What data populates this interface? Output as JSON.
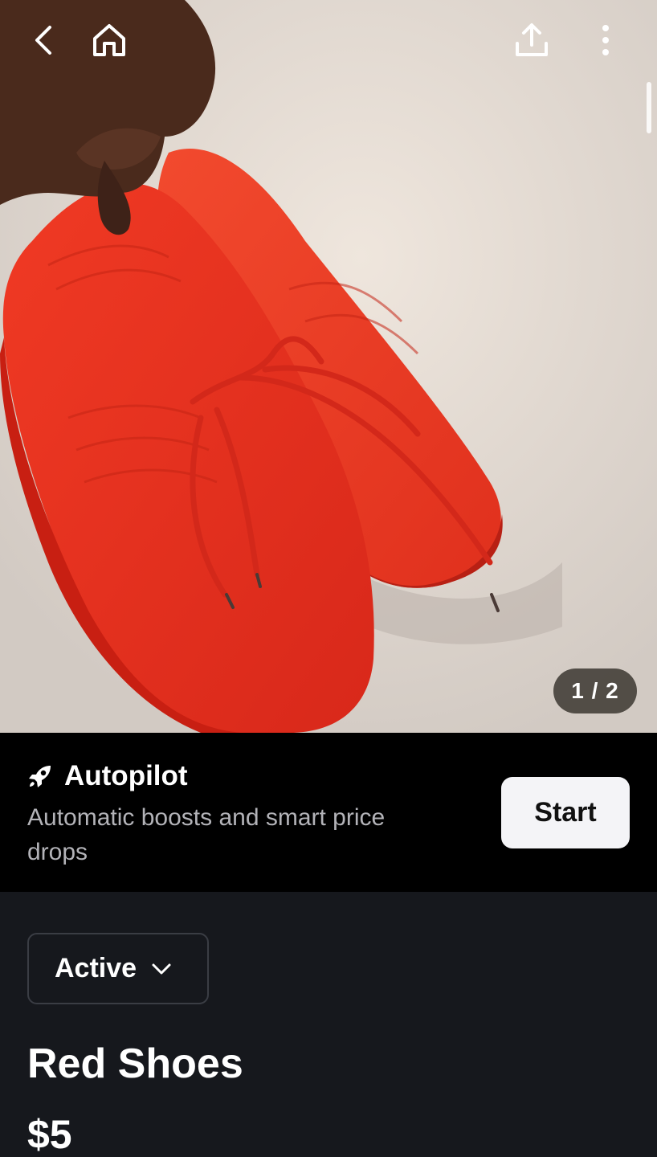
{
  "header": {
    "back_icon": "chevron-left-icon",
    "home_icon": "home-icon",
    "share_icon": "share-upload-icon",
    "more_icon": "more-vertical-icon"
  },
  "gallery": {
    "counter": "1 / 2",
    "image_description_icon": "product-photo"
  },
  "autopilot": {
    "icon": "rocket-icon",
    "title": "Autopilot",
    "description": "Automatic boosts and smart price drops",
    "button_label": "Start"
  },
  "listing": {
    "status": "Active",
    "title": "Red Shoes",
    "price": "$5"
  },
  "colors": {
    "banner_bg": "#000000",
    "page_bg": "#16181d",
    "button_bg": "#f4f4f7",
    "product_red": "#e8301c"
  }
}
